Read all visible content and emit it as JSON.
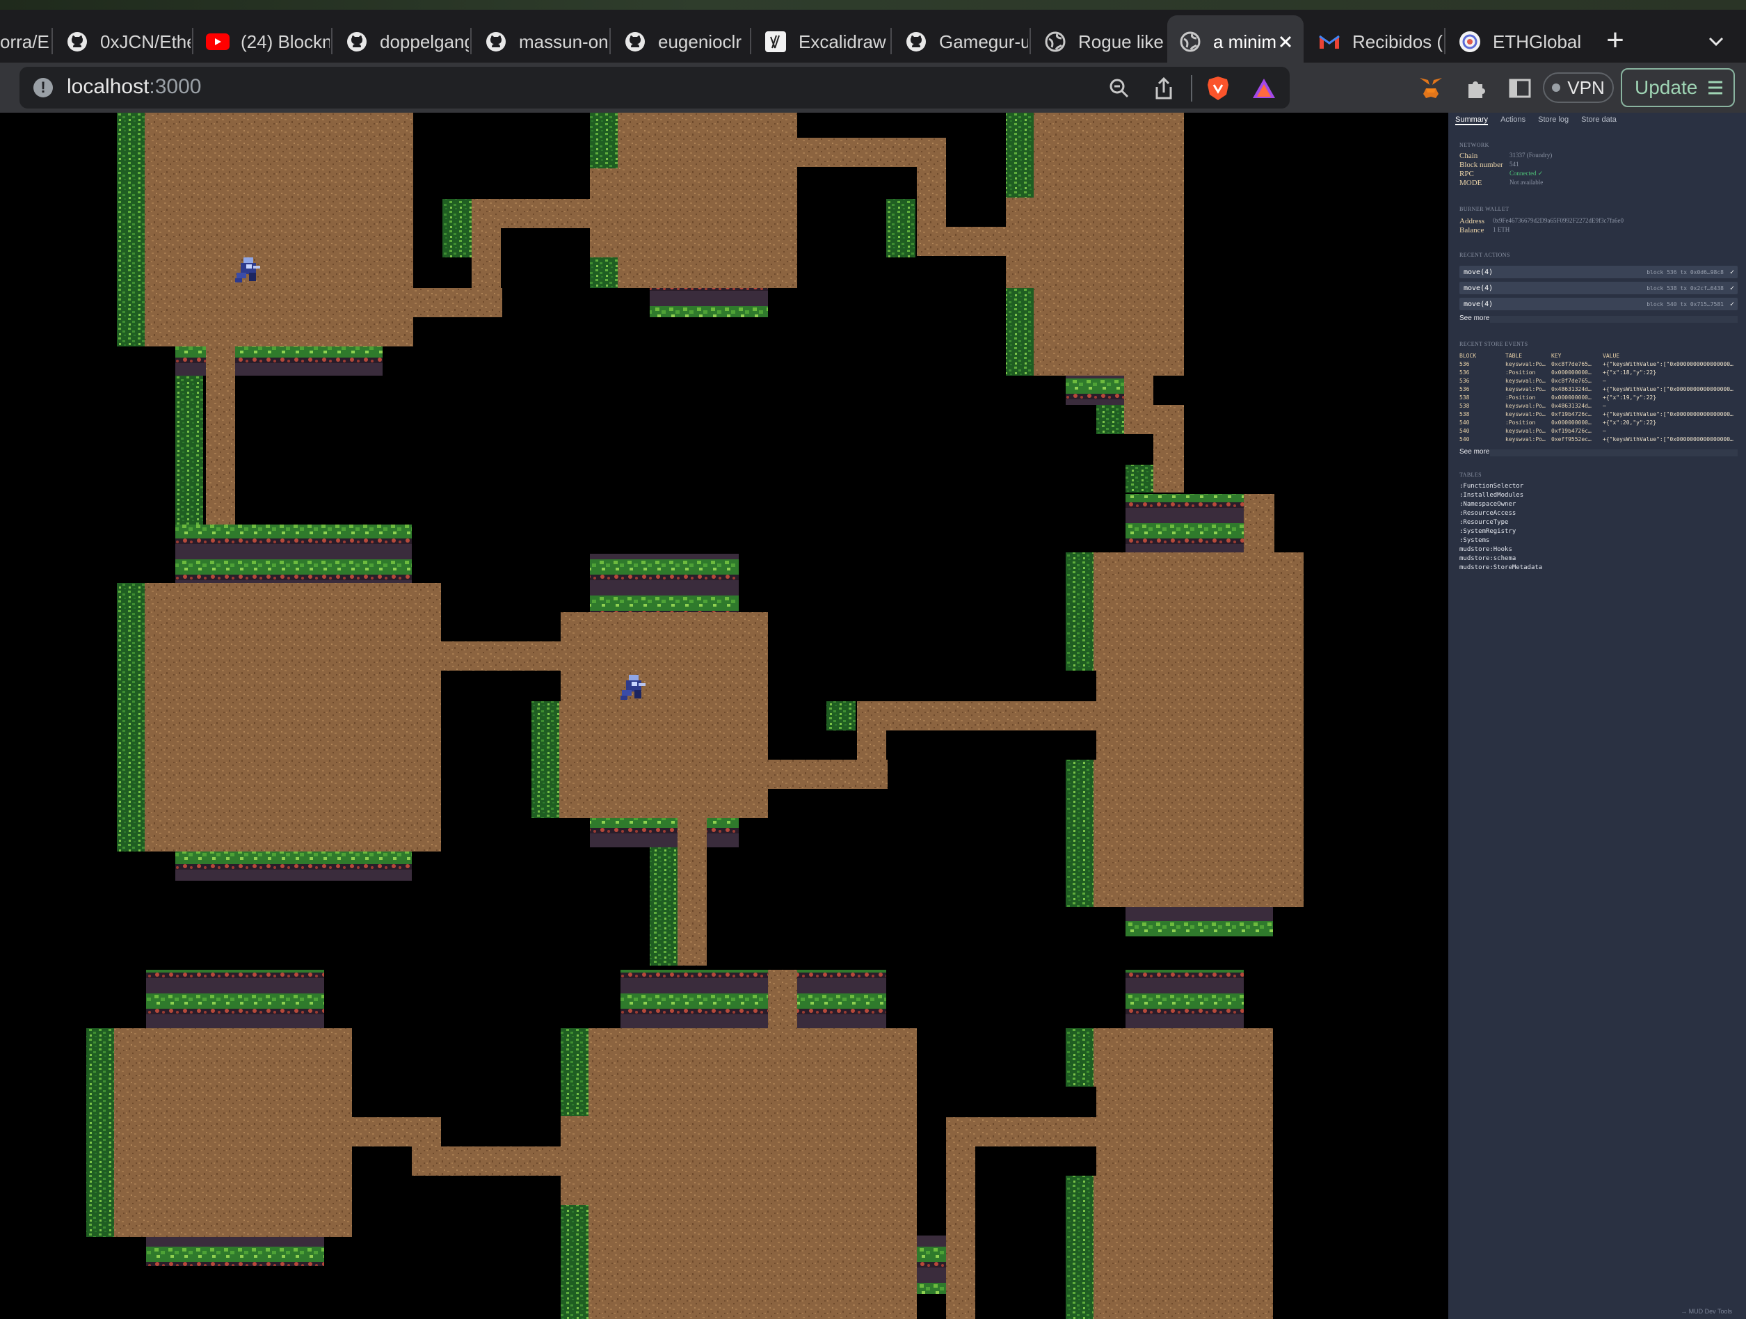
{
  "browser": {
    "tabs": [
      {
        "label": "orra/E",
        "icon": "none"
      },
      {
        "label": "0xJCN/Ethe",
        "icon": "github-icon"
      },
      {
        "label": "(24) Blockn",
        "icon": "youtube-icon"
      },
      {
        "label": "doppelgang",
        "icon": "github-icon"
      },
      {
        "label": "massun-on",
        "icon": "github-icon"
      },
      {
        "label": "eugenioclr",
        "icon": "github-icon"
      },
      {
        "label": "Excalidraw",
        "icon": "excalidraw-icon"
      },
      {
        "label": "Gamegur-u",
        "icon": "github-icon"
      },
      {
        "label": "Rogue like",
        "icon": "globe-icon"
      },
      {
        "label": "a minim",
        "icon": "globe-icon",
        "active": true
      },
      {
        "label": "Recibidos (",
        "icon": "gmail-icon"
      },
      {
        "label": "ETHGlobal",
        "icon": "ethglobal-icon"
      }
    ],
    "new_tab": "+",
    "url_host": "localhost",
    "url_port": ":3000",
    "vpn_label": "VPN",
    "update_label": "Update"
  },
  "devtools": {
    "tabs": [
      "Summary",
      "Actions",
      "Store log",
      "Store data"
    ],
    "network": {
      "section": "NETWORK",
      "rows": [
        {
          "k": "Chain",
          "v": "31337 (Foundry)"
        },
        {
          "k": "Block number",
          "v": "541"
        },
        {
          "k": "RPC",
          "v": "Connected ✓",
          "ok": true
        },
        {
          "k": "MODE",
          "v": "Not available"
        }
      ]
    },
    "wallet": {
      "section": "BURNER WALLET",
      "rows": [
        {
          "k": "Address",
          "v": "0x9Fe46736679d2D9a65F0992F2272dE9f3c7fa6e0"
        },
        {
          "k": "Balance",
          "v": "1 ETH"
        }
      ]
    },
    "actions": {
      "section": "RECENT ACTIONS",
      "items": [
        {
          "label": "move(4)",
          "meta": "block 536  tx 0x0d6…98c8",
          "check": "✓"
        },
        {
          "label": "move(4)",
          "meta": "block 538  tx 0x2cf…6438",
          "check": "✓"
        },
        {
          "label": "move(4)",
          "meta": "block 540  tx 0x715…7581",
          "check": "✓"
        }
      ],
      "see_more": "See more"
    },
    "events": {
      "section": "RECENT STORE EVENTS",
      "headers": [
        "BLOCK",
        "TABLE",
        "KEY",
        "VALUE"
      ],
      "rows": [
        [
          "536",
          "keyswval:Po…",
          "0xc8f7de765…",
          "+{\"keysWithValue\":[\"0x0000000000000000…"
        ],
        [
          "536",
          ":Position",
          "0x000000000…",
          "+{\"x\":18,\"y\":22}"
        ],
        [
          "536",
          "keyswval:Po…",
          "0xc8f7de765…",
          "–"
        ],
        [
          "536",
          "keyswval:Po…",
          "0x48631324d…",
          "+{\"keysWithValue\":[\"0x0000000000000000…"
        ],
        [
          "538",
          ":Position",
          "0x000000000…",
          "+{\"x\":19,\"y\":22}"
        ],
        [
          "538",
          "keyswval:Po…",
          "0x48631324d…",
          "–"
        ],
        [
          "538",
          "keyswval:Po…",
          "0xf19b4726c…",
          "+{\"keysWithValue\":[\"0x0000000000000000…"
        ],
        [
          "540",
          ":Position",
          "0x000000000…",
          "+{\"x\":20,\"y\":22}"
        ],
        [
          "540",
          "keyswval:Po…",
          "0xf19b4726c…",
          "–"
        ],
        [
          "540",
          "keyswval:Po…",
          "0xeff9552ec…",
          "+{\"keysWithValue\":[\"0x0000000000000000…"
        ]
      ],
      "see_more": "See more"
    },
    "tables": {
      "section": "TABLES",
      "items": [
        ":FunctionSelector",
        ":InstalledModules",
        ":NamespaceOwner",
        ":ResourceAccess",
        ":ResourceType",
        ":SystemRegistry",
        ":Systems",
        "mudstore:Hooks",
        "mudstore:schema",
        "mudstore:StoreMetadata"
      ]
    },
    "footer": "→ MUD Dev Tools"
  }
}
